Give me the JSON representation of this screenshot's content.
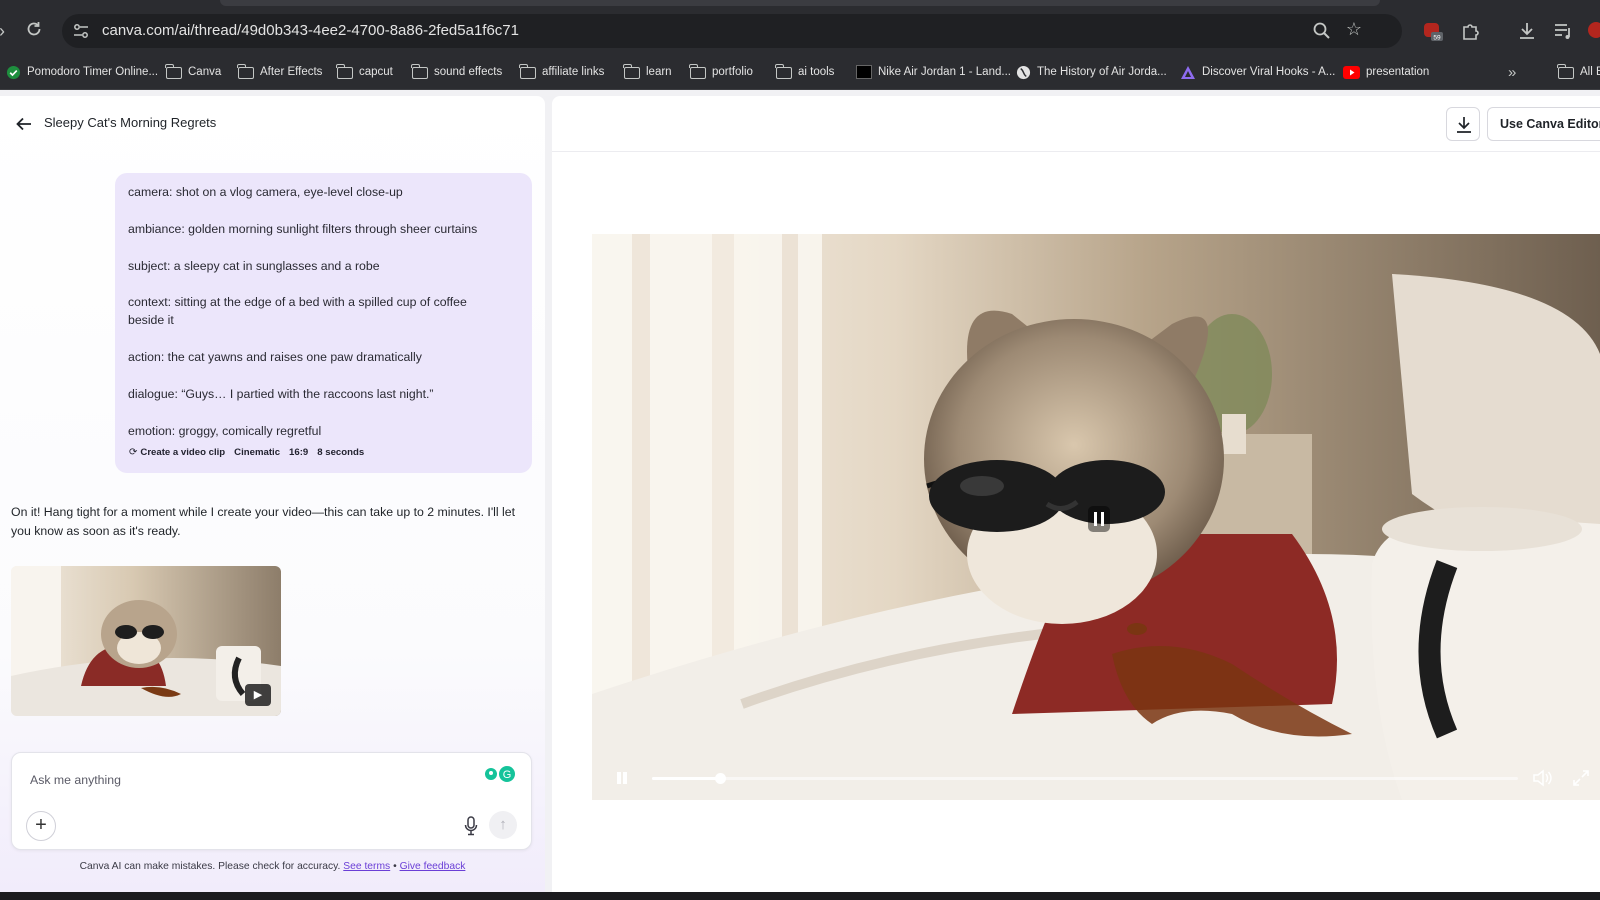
{
  "browser": {
    "url": "canva.com/ai/thread/49d0b343-4ee2-4700-8a86-2fed5a1f6c71",
    "extension_badge": "59",
    "bookmarks": [
      {
        "label": "Pomodoro Timer Online...",
        "icon": "check-circle-icon"
      },
      {
        "label": "Canva",
        "icon": "folder-icon"
      },
      {
        "label": "After Effects",
        "icon": "folder-icon"
      },
      {
        "label": "capcut",
        "icon": "folder-icon"
      },
      {
        "label": "sound effects",
        "icon": "folder-icon"
      },
      {
        "label": "affiliate links",
        "icon": "folder-icon"
      },
      {
        "label": "learn",
        "icon": "folder-icon"
      },
      {
        "label": "portfolio",
        "icon": "folder-icon"
      },
      {
        "label": "ai tools",
        "icon": "folder-icon"
      },
      {
        "label": "Nike Air Jordan 1 - Land...",
        "icon": "nike-icon"
      },
      {
        "label": "The History of Air Jorda...",
        "icon": "globe-icon"
      },
      {
        "label": "Discover Viral Hooks - A...",
        "icon": "triangle-logo-icon"
      },
      {
        "label": "presentation",
        "icon": "youtube-icon"
      },
      {
        "label": "All B",
        "icon": "folder-icon"
      }
    ]
  },
  "thread": {
    "title": "Sleepy Cat's Morning Regrets"
  },
  "prompt": {
    "lines": [
      "camera: shot on a vlog camera, eye-level close-up",
      "ambiance: golden morning sunlight filters through sheer curtains",
      "subject: a sleepy cat in sunglasses and a robe",
      "context: sitting at the edge of a bed with a spilled cup of coffee beside it",
      "action: the cat yawns and raises one paw dramatically",
      "dialogue: “Guys… I partied with the raccoons last night.”",
      "emotion: groggy, comically regretful"
    ],
    "chips": {
      "create": "Create a video clip",
      "style": "Cinematic",
      "ratio": "16:9",
      "duration": "8 seconds"
    }
  },
  "reply": {
    "text": "On it! Hang tight for a moment while I create your video—this can take up to 2 minutes. I'll let you know as soon as it's ready."
  },
  "composer": {
    "placeholder": "Ask me anything"
  },
  "disclaimer": {
    "text": "Canva AI can make mistakes. Please check for accuracy.",
    "see_terms": "See terms",
    "separator": "•",
    "feedback": "Give feedback"
  },
  "preview": {
    "editor_button": "Use Canva Editor",
    "progress_fraction": 0.078
  },
  "colors": {
    "accent": "#6a3fd6",
    "prompt_bubble": "#ece6fb",
    "browser_chrome": "#2b2c30"
  }
}
